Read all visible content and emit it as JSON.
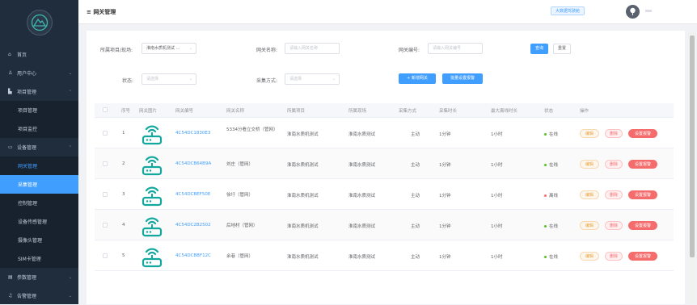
{
  "sidebar": {
    "items": [
      {
        "label": "首页",
        "icon": "home-icon"
      },
      {
        "label": "用户中心",
        "icon": "user-icon"
      },
      {
        "label": "项目管理",
        "icon": "folder-icon"
      },
      {
        "label": "项目管理"
      },
      {
        "label": "项目监控"
      },
      {
        "label": "设备管理",
        "icon": "monitor-icon"
      },
      {
        "label": "网关管理"
      },
      {
        "label": "采集管理"
      },
      {
        "label": "控制管理"
      },
      {
        "label": "设备传感管理"
      },
      {
        "label": "摄像头管理"
      },
      {
        "label": "SIM卡管理"
      },
      {
        "label": "参数管理",
        "icon": "document-icon"
      },
      {
        "label": "告警管理",
        "icon": "bell-icon"
      }
    ]
  },
  "header": {
    "title": "网关管理",
    "menu_icon": "≡",
    "screen_button": "大数据驾驶舱"
  },
  "filters": {
    "project_label": "所属项目/现场:",
    "project_value": "淮南水质机测试 ...",
    "name_label": "网关名称:",
    "name_placeholder": "请输入网关名称",
    "code_label": "网关编号:",
    "code_placeholder": "请输入网关编号",
    "search_button": "查询",
    "reset_button": "重置",
    "status_label": "状态:",
    "status_placeholder": "请选择",
    "method_label": "采集方式:",
    "method_placeholder": "请选择",
    "add_button": "+ 新增网关",
    "batch_button": "批量设置报警"
  },
  "table": {
    "headers": [
      "序号",
      "网关图片",
      "网关编号",
      "网关名称",
      "所属项目",
      "所属现场",
      "采集方式",
      "采集时长",
      "最大离线时长",
      "状态",
      "操作"
    ],
    "rows": [
      {
        "index": "1",
        "code": "4C54DC1830E3",
        "name": "5334分看立交桥（管网）",
        "project": "淮南水质机测试",
        "site": "淮南水质测试",
        "method": "主动",
        "duration": "1分钟",
        "max_offline": "1小时",
        "status": "在线",
        "status_color": "#52c41a"
      },
      {
        "index": "2",
        "code": "4C54DCB64B9A",
        "name": "刘庄（管网）",
        "project": "淮南水质机测试",
        "site": "淮南水质测试",
        "method": "主动",
        "duration": "1分钟",
        "max_offline": "1小时",
        "status": "在线",
        "status_color": "#52c41a"
      },
      {
        "index": "3",
        "code": "4C54DCBEF50E",
        "name": "徐圩（管网）",
        "project": "淮南水质机测试",
        "site": "淮南水质测试",
        "method": "主动",
        "duration": "1分钟",
        "max_offline": "1小时",
        "status": "离线",
        "status_color": "#f56c6c"
      },
      {
        "index": "4",
        "code": "4C54DC2B2502",
        "name": "后地村（管网）",
        "project": "淮南水质机测试",
        "site": "淮南水质测试",
        "method": "主动",
        "duration": "1分钟",
        "max_offline": "1小时",
        "status": "在线",
        "status_color": "#52c41a"
      },
      {
        "index": "5",
        "code": "4C54DCBBF12C",
        "name": "余巷（管网）",
        "project": "淮南水质机测试",
        "site": "淮南水质测试",
        "method": "主动",
        "duration": "1分钟",
        "max_offline": "1小时",
        "status": "在线",
        "status_color": "#52c41a"
      }
    ],
    "op_edit": "编辑",
    "op_delete": "删除",
    "op_alarm": "设置报警"
  },
  "colors": {
    "accent": "#409eff",
    "sidebar": "#1f2d3d",
    "router_icon": "#13a89e",
    "danger": "#f56c6c",
    "warning": "#e6a23c"
  }
}
